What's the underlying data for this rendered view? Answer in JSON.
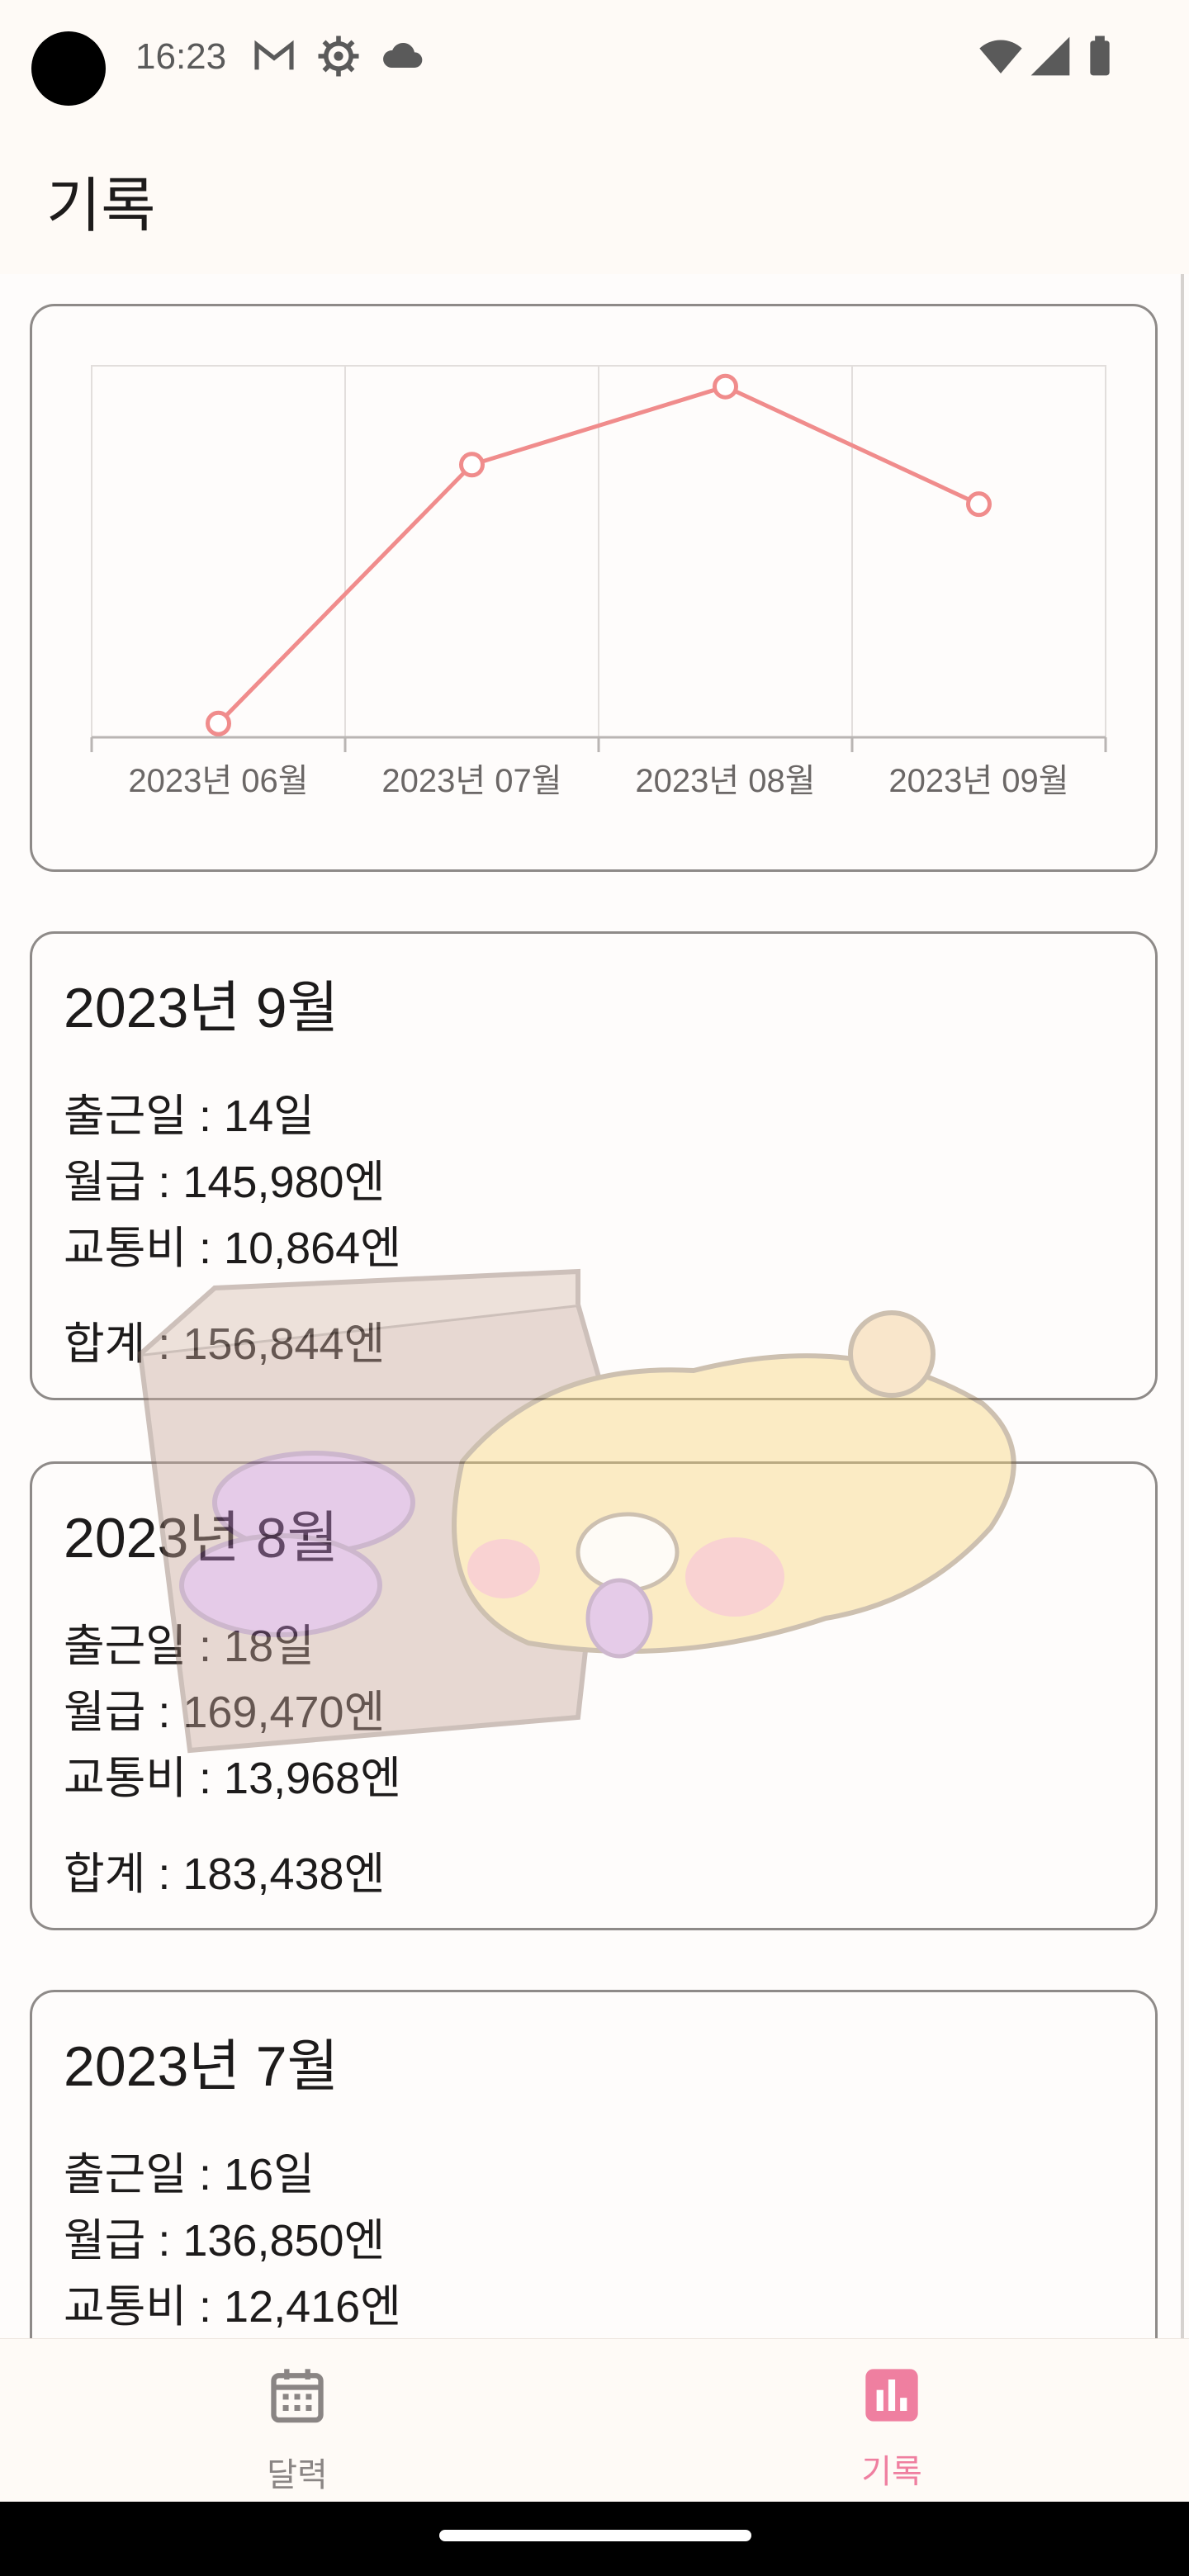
{
  "status_bar": {
    "time": "16:23",
    "icons_left": [
      "gmail-icon",
      "settings-icon",
      "cloud-icon"
    ],
    "icons_right": [
      "wifi-icon",
      "signal-icon",
      "battery-icon"
    ]
  },
  "app_bar": {
    "title": "기록"
  },
  "chart_data": {
    "type": "line",
    "categories": [
      "2023년 06월",
      "2023년 07월",
      "2023년 08월",
      "2023년 09월"
    ],
    "series": [
      {
        "values": [
          9300,
          183438,
          236000,
          156844
        ],
        "color": "#f08c8c"
      }
    ],
    "grid": true
  },
  "records": [
    {
      "title": "2023년 9월",
      "workdays": "출근일 : 14일",
      "salary": "월급 : 145,980엔",
      "transport": "교통비 : 10,864엔",
      "total": "합계 : 156,844엔"
    },
    {
      "title": "2023년 8월",
      "workdays": "출근일 : 18일",
      "salary": "월급 : 169,470엔",
      "transport": "교통비 : 13,968엔",
      "total": "합계 : 183,438엔"
    },
    {
      "title": "2023년 7월",
      "workdays": "출근일 : 16일",
      "salary": "월급 : 136,850엔",
      "transport": "교통비 : 12,416엔",
      "total": ""
    }
  ],
  "bottom_nav": {
    "items": [
      {
        "label": "달력",
        "icon": "calendar-icon",
        "active": false
      },
      {
        "label": "기록",
        "icon": "bar-chart-icon",
        "active": true
      }
    ],
    "active_color": "#ef7fa0",
    "inactive_color": "#8a8584"
  }
}
